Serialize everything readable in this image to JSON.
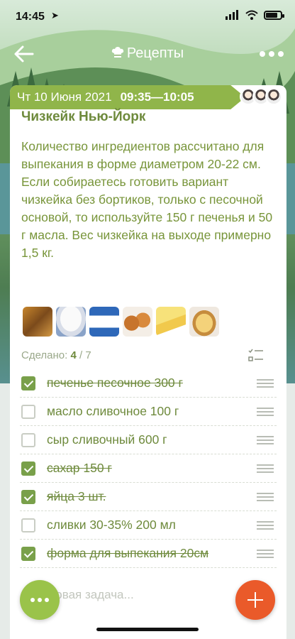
{
  "status_bar": {
    "time": "14:45",
    "location_icon": "location-arrow-icon",
    "signal_icon": "signal-bars-icon",
    "wifi_icon": "wifi-icon",
    "battery_icon": "battery-icon"
  },
  "nav": {
    "back_icon": "back-arrow-icon",
    "title": "Рецепты",
    "title_icon": "chef-hat-icon",
    "more_icon": "more-dots-icon"
  },
  "card": {
    "date": "Чт 10 Июня 2021",
    "time_range": "09:35—10:05",
    "title": "Чизкейк Нью-Йорк",
    "description": "Количество ингредиентов рассчитано для выпекания в форме диаметром 20-22 см. Если собираетесь готовить вариант чизкейка без бортиков, только с песочной основой, то используйте 150 г печенья и 50 г масла. Вес чизкейка на выходе примерно 1,5 кг.",
    "done_label": "Сделано:",
    "done_count": "4",
    "total_count": "/ 7",
    "checklist_icon": "checklist-icon"
  },
  "items": [
    {
      "label": "печенье песочное 300 г",
      "checked": true
    },
    {
      "label": "масло сливочное 100 г",
      "checked": false
    },
    {
      "label": "сыр сливочный 600 г",
      "checked": false
    },
    {
      "label": "сахар 150 г",
      "checked": true
    },
    {
      "label": "яйца 3 шт.",
      "checked": true
    },
    {
      "label": "сливки 30-35% 200 мл",
      "checked": false
    },
    {
      "label": "форма для выпекания 20см",
      "checked": true
    }
  ],
  "new_task_placeholder": "Новая задача...",
  "colors": {
    "accent_green": "#90b54a",
    "text_green": "#6e8a3c",
    "fab_orange": "#ea5a2a"
  }
}
